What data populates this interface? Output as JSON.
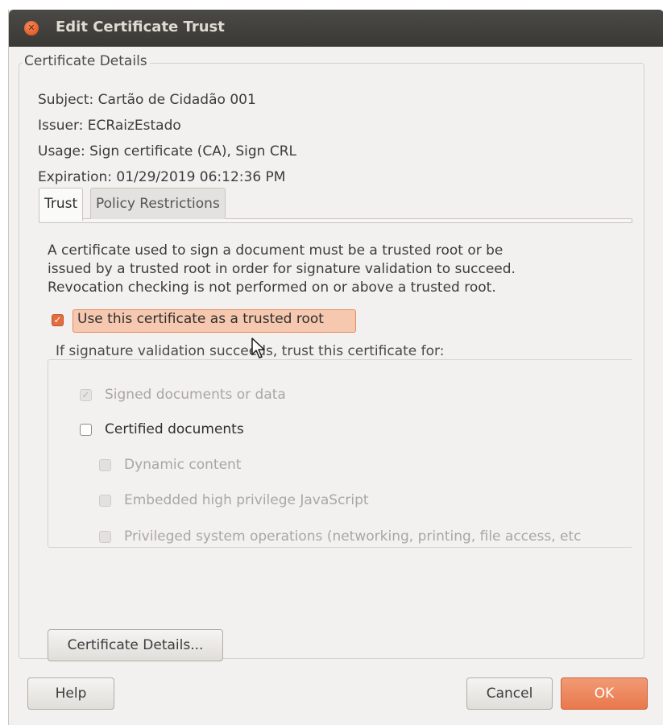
{
  "window": {
    "title": "Edit Certificate Trust",
    "icons": {
      "close": "close-icon"
    }
  },
  "details": {
    "legend": "Certificate Details",
    "subject": "Subject: Cartão de Cidadão 001",
    "issuer": "Issuer: ECRaizEstado",
    "usage": "Usage: Sign certificate (CA), Sign CRL",
    "expiration": "Expiration: 01/29/2019 06:12:36 PM"
  },
  "tabs": [
    {
      "label": "Trust",
      "active": true
    },
    {
      "label": "Policy Restrictions",
      "active": false
    }
  ],
  "trust": {
    "description_line1": "A certificate used to sign a document must be a trusted root or be",
    "description_line2": "issued by a trusted root in order for signature validation to succeed.",
    "description_line3": "Revocation checking is not performed on or above a trusted root.",
    "trusted_root_label": "Use this certificate as a trusted root",
    "trusted_root_checked": true,
    "group_legend": "If signature validation succeeds, trust this certificate for:",
    "options": [
      {
        "label": "Signed documents or data",
        "checked": true,
        "enabled": false
      },
      {
        "label": "Certified documents",
        "checked": false,
        "enabled": true
      },
      {
        "label": "Dynamic content",
        "checked": false,
        "enabled": false
      },
      {
        "label": "Embedded high privilege JavaScript",
        "checked": false,
        "enabled": false
      },
      {
        "label": "Privileged system operations (networking, printing, file access, etc",
        "checked": false,
        "enabled": false
      }
    ]
  },
  "buttons": {
    "certificate_details": "Certificate Details...",
    "help": "Help",
    "cancel": "Cancel",
    "ok": "OK"
  },
  "colors": {
    "accent": "#e36d3d",
    "titlebar": "#3c3b37",
    "background": "#f2f1f0"
  }
}
